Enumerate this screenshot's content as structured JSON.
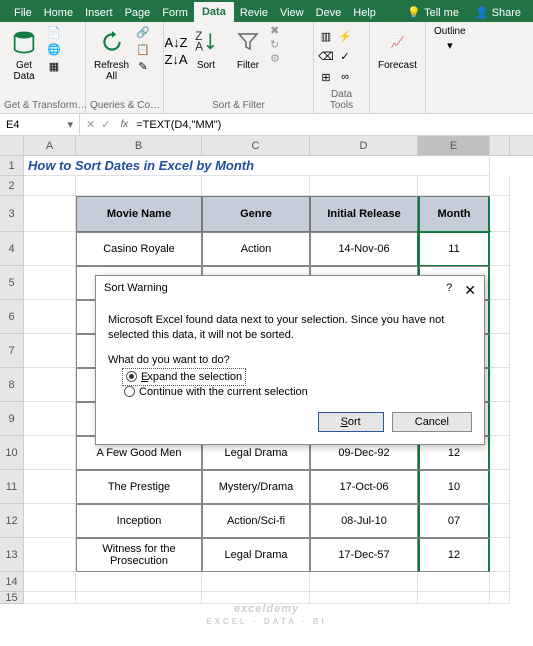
{
  "tabs": [
    "File",
    "Home",
    "Insert",
    "Page",
    "Form",
    "Data",
    "Revie",
    "View",
    "Deve",
    "Help"
  ],
  "tell_me": "Tell me",
  "share": "Share",
  "ribbon": {
    "get_data": "Get\nData",
    "get_transform": "Get & Transform…",
    "refresh": "Refresh\nAll",
    "queries": "Queries & Co…",
    "sort": "Sort",
    "filter": "Filter",
    "sort_filter": "Sort & Filter",
    "data_tools": "Data\nTools",
    "forecast": "Forecast",
    "outline": "Outline"
  },
  "namebox": "E4",
  "formula": "=TEXT(D4,\"MM\")",
  "cols": [
    "A",
    "B",
    "C",
    "D",
    "E"
  ],
  "title_row": "How to Sort Dates in Excel by Month",
  "headers": [
    "Movie Name",
    "Genre",
    "Initial Release",
    "Month"
  ],
  "rows": [
    {
      "r": "4",
      "b": "Casino Royale",
      "c": "Action",
      "d": "14-Nov-06",
      "e": "11"
    },
    {
      "r": "5",
      "b": "",
      "c": "",
      "d": "",
      "e": ""
    },
    {
      "r": "6",
      "b": "",
      "c": "",
      "d": "",
      "e": ""
    },
    {
      "r": "7",
      "b": "",
      "c": "",
      "d": "",
      "e": ""
    },
    {
      "r": "8",
      "b": "",
      "c": "",
      "d": "",
      "e": ""
    },
    {
      "r": "9",
      "b": "",
      "c": "",
      "d": "",
      "e": ""
    },
    {
      "r": "10",
      "b": "A Few Good Men",
      "c": "Legal Drama",
      "d": "09-Dec-92",
      "e": "12"
    },
    {
      "r": "11",
      "b": "The Prestige",
      "c": "Mystery/Drama",
      "d": "17-Oct-06",
      "e": "10"
    },
    {
      "r": "12",
      "b": "Inception",
      "c": "Action/Sci-fi",
      "d": "08-Jul-10",
      "e": "07"
    },
    {
      "r": "13",
      "b": "Witness for the\nProsecution",
      "c": "Legal Drama",
      "d": "17-Dec-57",
      "e": "12"
    }
  ],
  "dialog": {
    "title": "Sort Warning",
    "msg": "Microsoft Excel found data next to your selection.  Since you have not selected this data, it will not be sorted.",
    "q": "What do you want to do?",
    "opt1": "Expand the selection",
    "opt2": "Continue with the current selection",
    "sort": "Sort",
    "cancel": "Cancel"
  },
  "watermark": "exceldemy",
  "watermark_sub": "EXCEL · DATA · BI"
}
